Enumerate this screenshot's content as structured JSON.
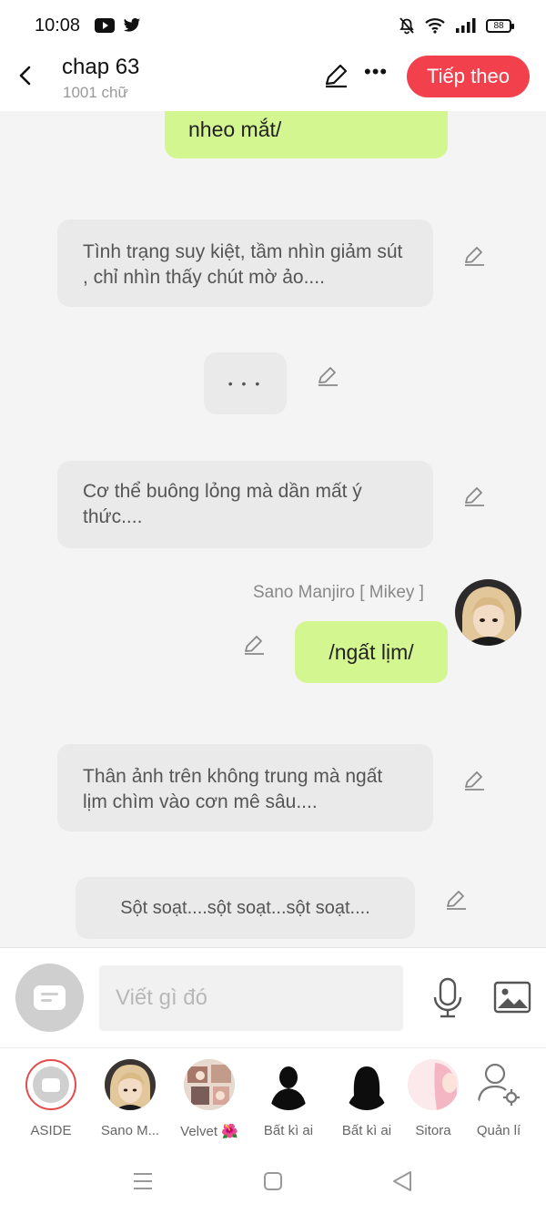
{
  "status_bar": {
    "time": "10:08",
    "battery": "88"
  },
  "header": {
    "title": "chap 63",
    "subtitle": "1001 chữ",
    "next_label": "Tiếp theo"
  },
  "messages": [
    {
      "type": "green",
      "text": "nheo mắt/"
    },
    {
      "type": "grey",
      "text": "Tình trạng suy kiệt, tầm nhìn giảm sút , chỉ nhìn thấy chút mờ ảo...."
    },
    {
      "type": "grey",
      "text": "• • •"
    },
    {
      "type": "grey",
      "text": "Cơ thể buông lỏng mà dần mất ý thức...."
    },
    {
      "type": "green",
      "speaker": "Sano Manjiro [ Mikey ]",
      "text": "/ngất lịm/"
    },
    {
      "type": "grey",
      "text": "Thân ảnh trên không trung mà ngất lịm chìm vào cơn mê sâu...."
    },
    {
      "type": "grey",
      "text": "Sột soạt....sột soạt...sột soạt...."
    }
  ],
  "input": {
    "placeholder": "Viết gì đó"
  },
  "characters": [
    {
      "label": "ASIDE"
    },
    {
      "label": "Sano M..."
    },
    {
      "label": "Velvet 🌺"
    },
    {
      "label": "Bất kì ai"
    },
    {
      "label": "Bất kì ai"
    },
    {
      "label": "Sitora"
    },
    {
      "label": "Quản lí"
    }
  ],
  "colors": {
    "accent": "#f2414c",
    "green_bubble": "#d4f690",
    "grey_bubble": "#eaeaea"
  }
}
